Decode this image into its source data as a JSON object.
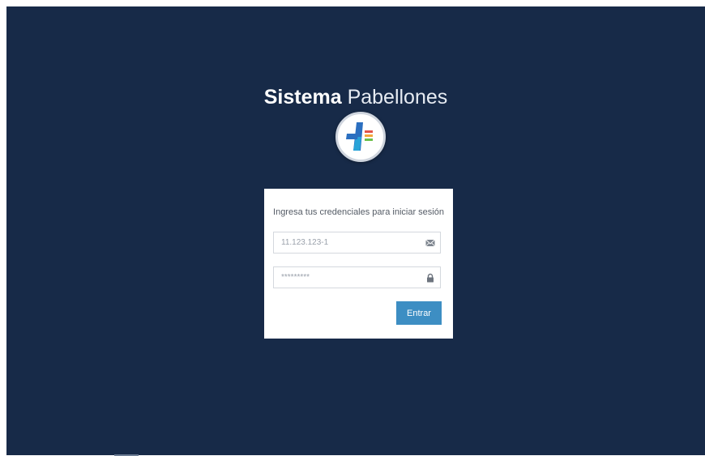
{
  "header": {
    "title_strong": "Sistema",
    "title_light": "Pabellones"
  },
  "logo": {
    "icon": "hospital-plus-logo-icon",
    "colors": [
      "#2b6fc0",
      "#29a3d8",
      "#e2534a",
      "#f4a63a",
      "#6cbf4a"
    ]
  },
  "login": {
    "subtitle": "Ingresa tus credenciales para iniciar sesión",
    "username": {
      "placeholder": "11.123.123-1",
      "icon": "envelope-icon"
    },
    "password": {
      "placeholder": "*********",
      "icon": "lock-icon"
    },
    "submit_label": "Entrar"
  },
  "colors": {
    "background": "#172a48",
    "accent": "#3d8ec3"
  }
}
